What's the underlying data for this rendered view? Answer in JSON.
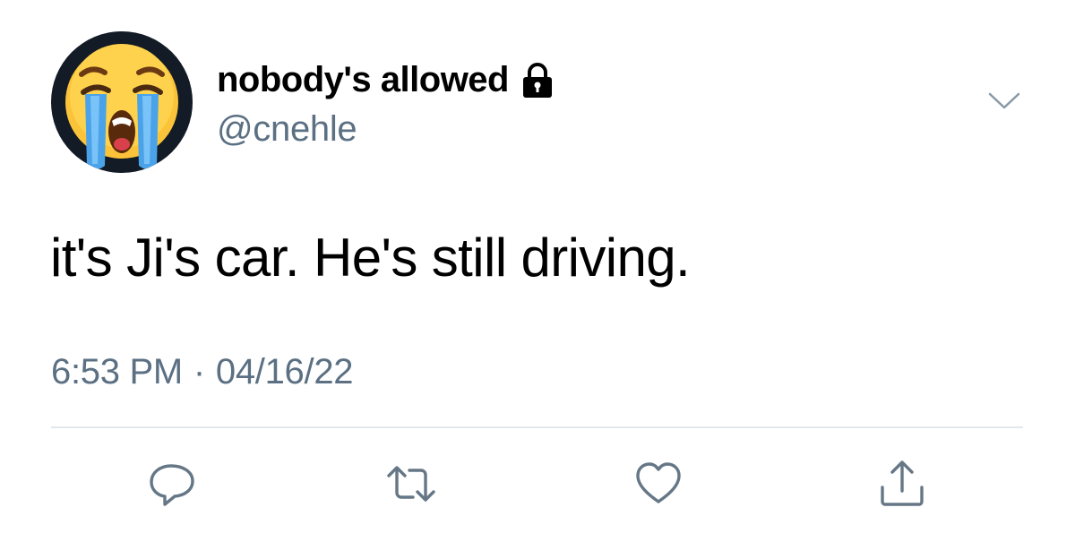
{
  "author": {
    "display_name": "nobody's allowed",
    "handle": "@cnehle",
    "avatar_icon": "loudly-crying-face-emoji",
    "protected_icon": "lock-icon"
  },
  "tweet": {
    "text": "it's Ji's car. He's still driving.",
    "time": "6:53 PM",
    "separator": "·",
    "date": "04/16/22"
  },
  "actions": [
    {
      "name": "reply",
      "icon": "reply-icon"
    },
    {
      "name": "retweet",
      "icon": "retweet-icon"
    },
    {
      "name": "like",
      "icon": "heart-icon"
    },
    {
      "name": "share",
      "icon": "share-icon"
    }
  ],
  "colors": {
    "text": "#000000",
    "secondary": "#5b7083",
    "divider": "#e1e8ed",
    "avatar_bg": "#121b26"
  }
}
